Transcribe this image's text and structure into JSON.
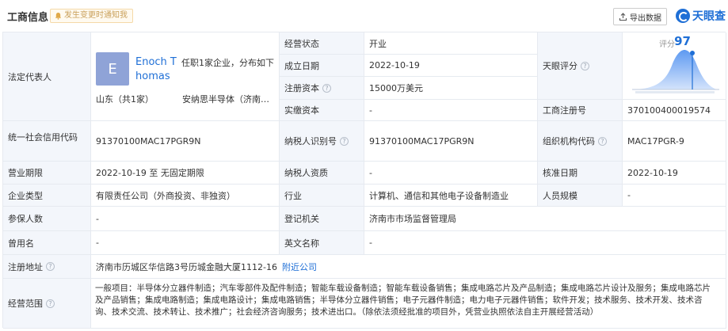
{
  "header": {
    "title": "工商信息",
    "notify_label": "发生变更时通知我",
    "export_label": "导出数据",
    "logo_text": "天眼查",
    "brand_color": "#1f6fd6"
  },
  "legal_rep": {
    "label": "法定代表人",
    "avatar_letter": "E",
    "name": "Enoch Thomas",
    "desc": "任职1家企业，分布如下",
    "location": "山东（共1家）",
    "company": "安纳思半导体（济南…"
  },
  "basic": {
    "status_label": "经营状态",
    "status_value": "开业",
    "founded_label": "成立日期",
    "founded_value": "2022-10-19",
    "capital_label": "注册资本",
    "capital_value": "15000万美元",
    "paid_label": "实缴资本",
    "paid_value": "-",
    "tianyan_label": "天眼评分",
    "score_label": "评分",
    "score_value": "97",
    "reg_no_label": "工商注册号",
    "reg_no_value": "370100400019574"
  },
  "rows": {
    "credit_code_label": "统一社会信用代码",
    "credit_code_value": "91370100MAC17PGR9N",
    "taxpayer_id_label": "纳税人识别号",
    "taxpayer_id_value": "91370100MAC17PGR9N",
    "org_code_label": "组织机构代码",
    "org_code_value": "MAC17PGR-9",
    "term_label": "营业期限",
    "term_value": "2022-10-19 至 无固定期限",
    "taxpayer_qual_label": "纳税人资质",
    "taxpayer_qual_value": "-",
    "approval_label": "核准日期",
    "approval_value": "2022-10-19",
    "type_label": "企业类型",
    "type_value": "有限责任公司（外商投资、非独资）",
    "industry_label": "行业",
    "industry_value": "计算机、通信和其他电子设备制造业",
    "staff_label": "人员规模",
    "staff_value": "-",
    "insured_label": "参保人数",
    "insured_value": "-",
    "authority_label": "登记机关",
    "authority_value": "济南市市场监督管理局",
    "former_label": "曾用名",
    "former_value": "-",
    "english_label": "英文名称",
    "english_value": "-",
    "address_label": "注册地址",
    "address_value": "济南市历城区华信路3号历城金融大厦1112-16",
    "address_link": "附近公司",
    "scope_label": "经营范围",
    "scope_value": "一般项目：半导体分立器件制造；汽车零部件及配件制造；智能车载设备制造；智能车载设备销售；集成电路芯片及产品制造；集成电路芯片设计及服务；集成电路芯片及产品销售；集成电路制造；集成电路设计；集成电路销售；半导体分立器件销售；电子元器件制造；电力电子元器件销售；软件开发；技术服务、技术开发、技术咨询、技术交流、技术转让、技术推广；社会经济咨询服务；技术进出口。（除依法须经批准的项目外，凭营业执照依法自主开展经营活动）"
  },
  "help_icon_glyph": "?"
}
